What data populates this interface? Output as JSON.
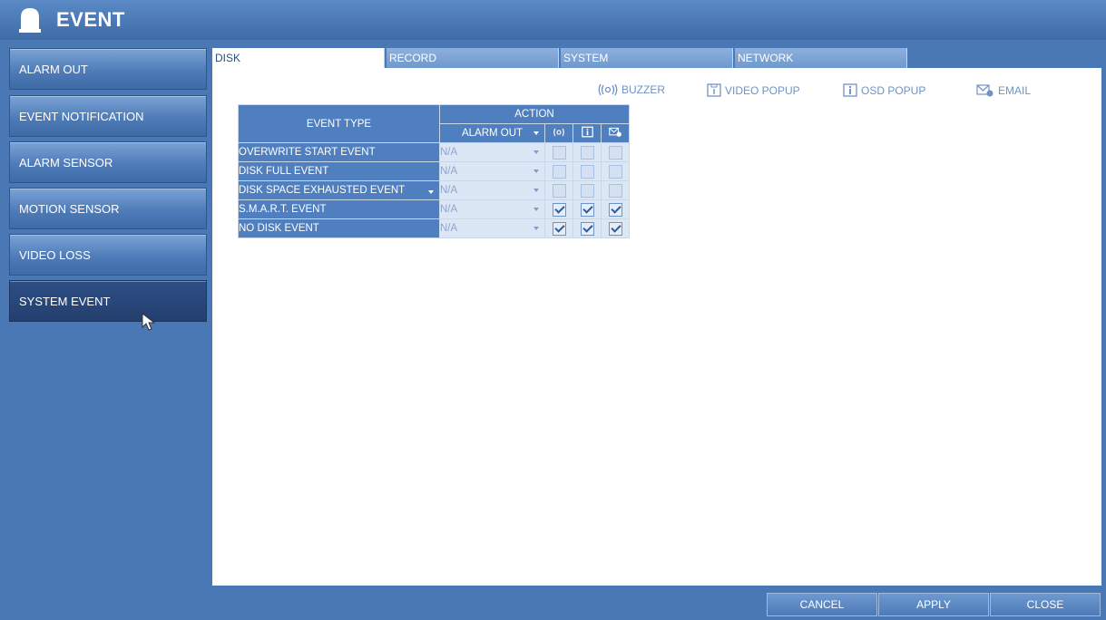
{
  "window": {
    "title": "EVENT"
  },
  "sidebar": {
    "items": [
      {
        "label": "ALARM OUT"
      },
      {
        "label": "EVENT NOTIFICATION"
      },
      {
        "label": "ALARM SENSOR"
      },
      {
        "label": "MOTION SENSOR"
      },
      {
        "label": "VIDEO LOSS"
      },
      {
        "label": "SYSTEM EVENT",
        "active": true
      }
    ]
  },
  "tabs": [
    {
      "label": "DISK",
      "active": true
    },
    {
      "label": "RECORD"
    },
    {
      "label": "SYSTEM"
    },
    {
      "label": "NETWORK"
    }
  ],
  "legend": {
    "buzzer": "BUZZER",
    "video_popup": "VIDEO POPUP",
    "osd_popup": "OSD POPUP",
    "email": "EMAIL"
  },
  "table": {
    "event_type_header": "EVENT TYPE",
    "action_header": "ACTION",
    "alarm_out_header": "ALARM OUT",
    "rows": [
      {
        "name": "OVERWRITE START EVENT",
        "alarm_out": "N/A",
        "buzzer": false,
        "osd": false,
        "email": false
      },
      {
        "name": "DISK FULL EVENT",
        "alarm_out": "N/A",
        "buzzer": false,
        "osd": false,
        "email": false
      },
      {
        "name": "DISK SPACE EXHAUSTED EVENT",
        "alarm_out": "N/A",
        "buzzer": false,
        "osd": false,
        "email": false
      },
      {
        "name": "S.M.A.R.T. EVENT",
        "alarm_out": "N/A",
        "buzzer": true,
        "osd": true,
        "email": true
      },
      {
        "name": "NO DISK EVENT",
        "alarm_out": "N/A",
        "buzzer": true,
        "osd": true,
        "email": true
      }
    ]
  },
  "buttons": {
    "cancel": "CANCEL",
    "apply": "APPLY",
    "close": "CLOSE"
  },
  "colors": {
    "background": "#4a78b4",
    "table_header": "#4f7fbf",
    "cell_bg": "#dce7f5"
  }
}
